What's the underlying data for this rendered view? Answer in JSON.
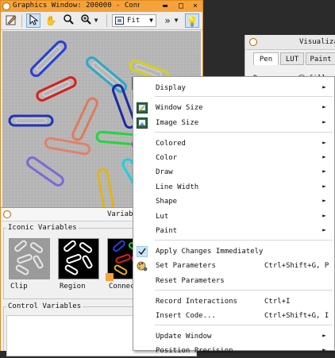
{
  "graphics_window": {
    "title": "Graphics Window: 200000 - Conn",
    "zoom_select": "Fit",
    "more_tools": "»"
  },
  "variables_window": {
    "title": "Variab",
    "iconic_header": "Iconic Variables",
    "iconic_items": [
      {
        "label": "Clip"
      },
      {
        "label": "Region"
      },
      {
        "label": "Connecte"
      }
    ],
    "control_header": "Control Variables"
  },
  "visualization_window": {
    "title": "Visualiza",
    "tabs": [
      {
        "label": "Pen"
      },
      {
        "label": "LUT"
      },
      {
        "label": "Paint"
      }
    ],
    "row_label": "D",
    "radio_label": "fill"
  },
  "context_menu": {
    "items": [
      {
        "label": "Display",
        "submenu": true
      },
      {
        "label": "Window Size",
        "submenu": true
      },
      {
        "label": "Image Size",
        "submenu": true
      },
      {
        "label": "Colored",
        "submenu": true
      },
      {
        "label": "Color",
        "submenu": true
      },
      {
        "label": "Draw",
        "submenu": true
      },
      {
        "label": "Line Width",
        "submenu": true
      },
      {
        "label": "Shape",
        "submenu": true
      },
      {
        "label": "Lut",
        "submenu": true
      },
      {
        "label": "Paint",
        "submenu": true
      },
      {
        "label": "Apply Changes Immediately",
        "checked": true
      },
      {
        "label": "Set Parameters",
        "shortcut": "Ctrl+Shift+G, P"
      },
      {
        "label": "Reset Parameters"
      },
      {
        "label": "Record Interactions",
        "shortcut": "Ctrl+I"
      },
      {
        "label": "Insert Code...",
        "shortcut": "Ctrl+Shift+G, I"
      },
      {
        "label": "Update Window",
        "submenu": true
      },
      {
        "label": "Position Precision",
        "submenu": true
      }
    ],
    "submenu_arrow": "►"
  },
  "colors": {
    "accent": "#f6a23a",
    "check_bg": "#cce4f7"
  }
}
